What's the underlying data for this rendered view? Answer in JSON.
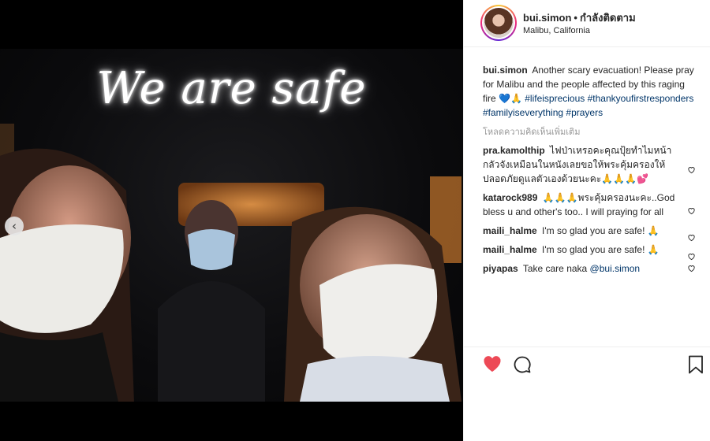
{
  "photo": {
    "overlay_text": "We are safe"
  },
  "header": {
    "username": "bui.simon",
    "separator": "•",
    "follow_label": "กำลังติดตาม",
    "location": "Malibu, California"
  },
  "caption": {
    "username": "bui.simon",
    "text": "Another scary evacuation! Please pray for Malibu and the people affected by this raging fire 💙🙏",
    "hashtags": [
      "#lifeisprecious",
      "#thankyoufirstresponders",
      "#familyiseverything",
      "#prayers"
    ]
  },
  "load_more_label": "โหลดความคิดเห็นเพิ่มเติม",
  "comments": [
    {
      "username": "pra.kamolthip",
      "text": "ไฟป่าเหรอคะคุณปุ้ยทำไมหน้ากลัวจังเหมือนในหนังเลยขอให้พระคุ้มครองให้ปลอดภัยดูแลตัวเองด้วยนะคะ🙏🙏🙏💕"
    },
    {
      "username": "katarock989",
      "text": "🙏🙏🙏พระคุ้มครองนะคะ..God bless u and other's too.. I will praying for all"
    },
    {
      "username": "maili_halme",
      "text": "I'm so glad you are safe! 🙏"
    },
    {
      "username": "maili_halme",
      "text": "I'm so glad you are safe! 🙏"
    },
    {
      "username": "piyapas",
      "text": "Take care naka ",
      "mention": "@bui.simon"
    }
  ],
  "colors": {
    "like_red": "#ed4956",
    "hashtag_blue": "#003569",
    "muted_gray": "#999999"
  },
  "icons": {
    "carousel_prev": "‹",
    "like": "heart-filled-icon",
    "comment": "speech-bubble-icon",
    "save": "bookmark-icon",
    "comment_like": "heart-outline-icon"
  }
}
